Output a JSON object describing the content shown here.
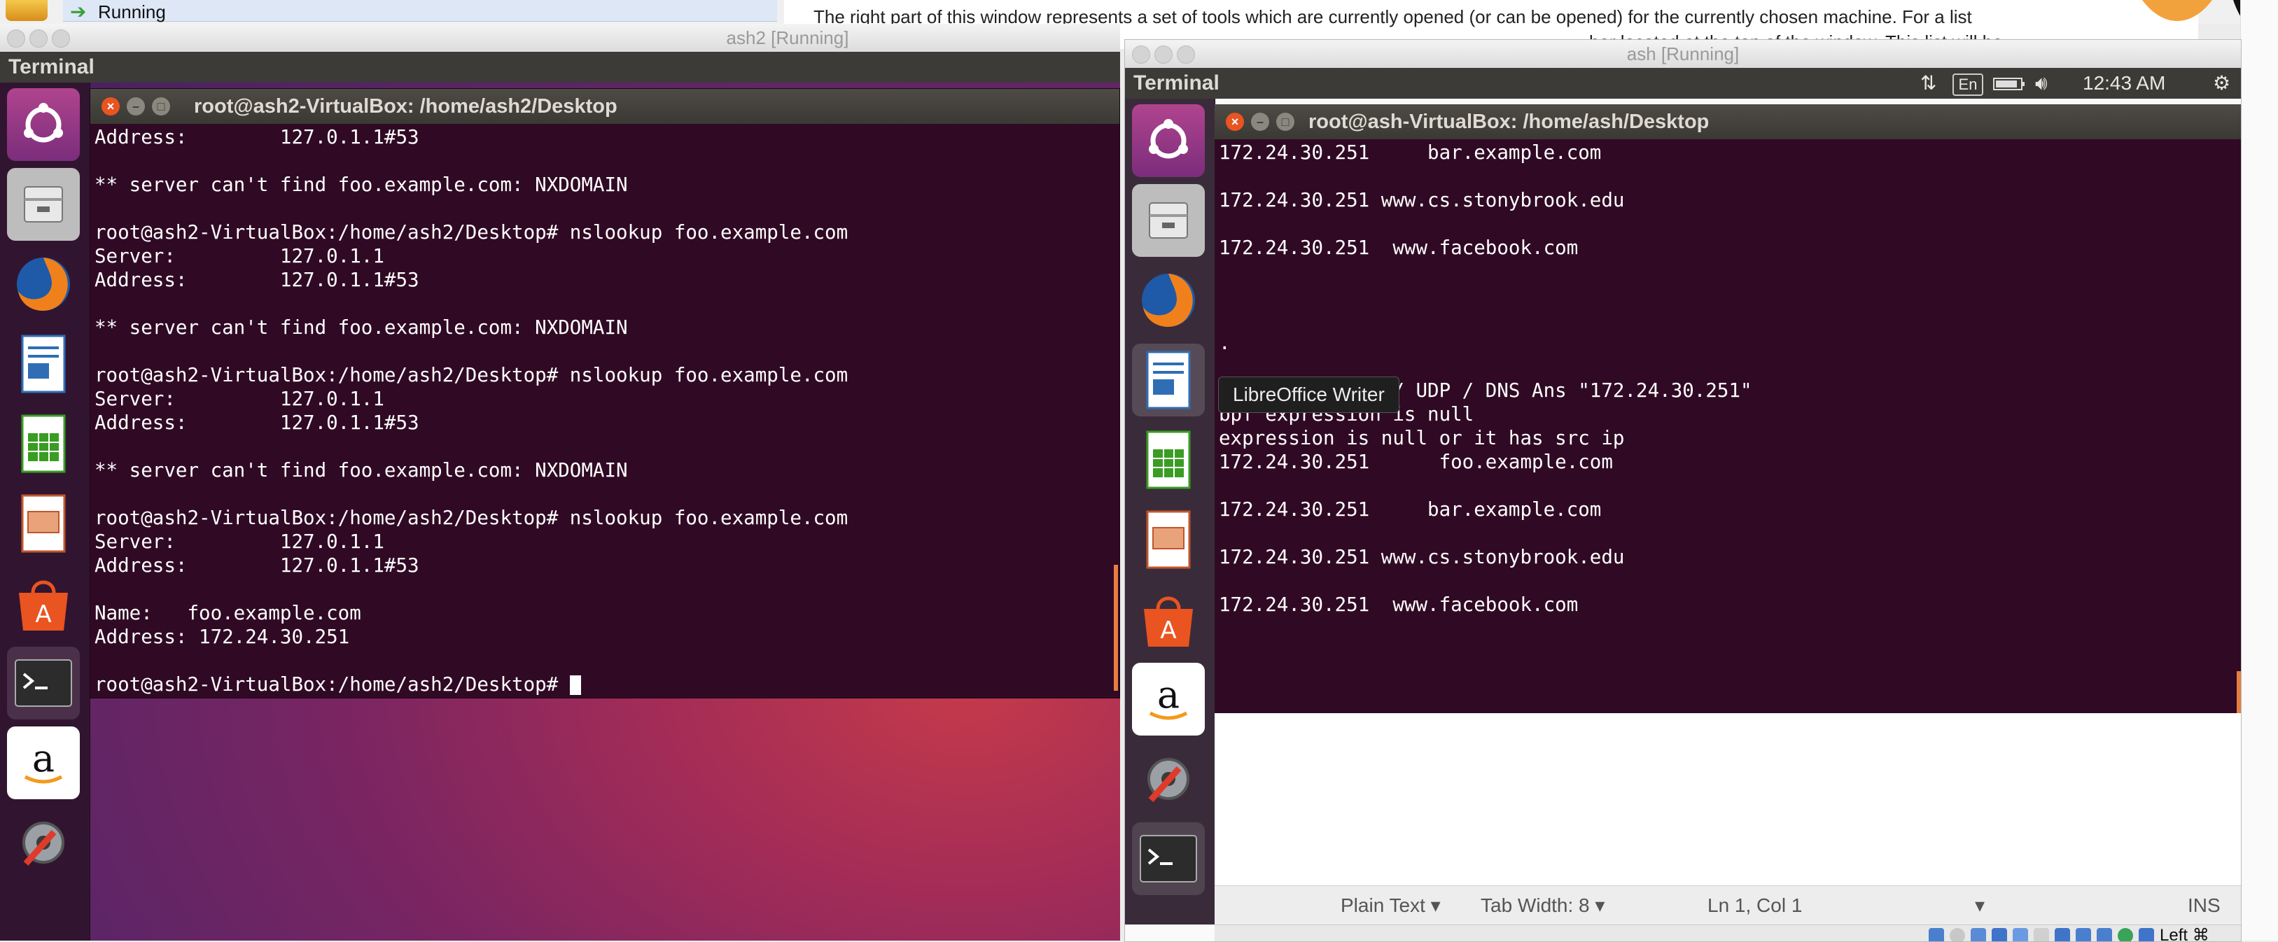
{
  "host": {
    "running_label": "Running",
    "help_text_line1": "The right part of this window represents a set of tools which are currently opened (or can be opened) for the currently chosen machine. For a list",
    "help_text_line2": "bar located at the top of the window. This list will be"
  },
  "vm1": {
    "window_title": "ash2 [Running]",
    "panel_title": "Terminal",
    "terminal_title": "root@ash2-VirtualBox: /home/ash2/Desktop",
    "lines": [
      "Address:        127.0.1.1#53",
      "",
      "** server can't find foo.example.com: NXDOMAIN",
      "",
      "root@ash2-VirtualBox:/home/ash2/Desktop# nslookup foo.example.com",
      "Server:         127.0.1.1",
      "Address:        127.0.1.1#53",
      "",
      "** server can't find foo.example.com: NXDOMAIN",
      "",
      "root@ash2-VirtualBox:/home/ash2/Desktop# nslookup foo.example.com",
      "Server:         127.0.1.1",
      "Address:        127.0.1.1#53",
      "",
      "** server can't find foo.example.com: NXDOMAIN",
      "",
      "root@ash2-VirtualBox:/home/ash2/Desktop# nslookup foo.example.com",
      "Server:         127.0.1.1",
      "Address:        127.0.1.1#53",
      "",
      "Name:   foo.example.com",
      "Address: 172.24.30.251",
      ""
    ],
    "prompt": "root@ash2-VirtualBox:/home/ash2/Desktop# "
  },
  "vm2": {
    "window_title": "ash [Running]",
    "panel_title": "Terminal",
    "terminal_title": "root@ash-VirtualBox: /home/ash/Desktop",
    "keyboard_layout": "En",
    "clock": "12:43 AM",
    "lines": [
      "172.24.30.251     bar.example.com",
      "",
      "172.24.30.251 www.cs.stonybrook.edu",
      "",
      "172.24.30.251  www.facebook.com",
      "",
      "",
      "",
      ".",
      "",
      "Sent packet IP / UDP / DNS Ans \"172.24.30.251\"",
      "bpf expression is null",
      "expression is null or it has src ip",
      "172.24.30.251      foo.example.com",
      "",
      "172.24.30.251     bar.example.com",
      "",
      "172.24.30.251 www.cs.stonybrook.edu",
      "",
      "172.24.30.251  www.facebook.com"
    ],
    "tooltip": "LibreOffice Writer",
    "status": {
      "syntax": "Plain Text",
      "tab_width": "Tab Width: 8",
      "position": "Ln 1, Col 1",
      "mode": "INS"
    },
    "host_key": "Left ⌘"
  },
  "colors": {
    "terminal_bg": "#300a24",
    "ubuntu_orange": "#e95420",
    "panel": "#3c3b37"
  },
  "launcher_icons": [
    "ubuntu-dash-icon",
    "files-icon",
    "firefox-icon",
    "writer-icon",
    "calc-icon",
    "impress-icon",
    "software-center-icon",
    "terminal-icon",
    "amazon-icon",
    "system-settings-icon"
  ]
}
